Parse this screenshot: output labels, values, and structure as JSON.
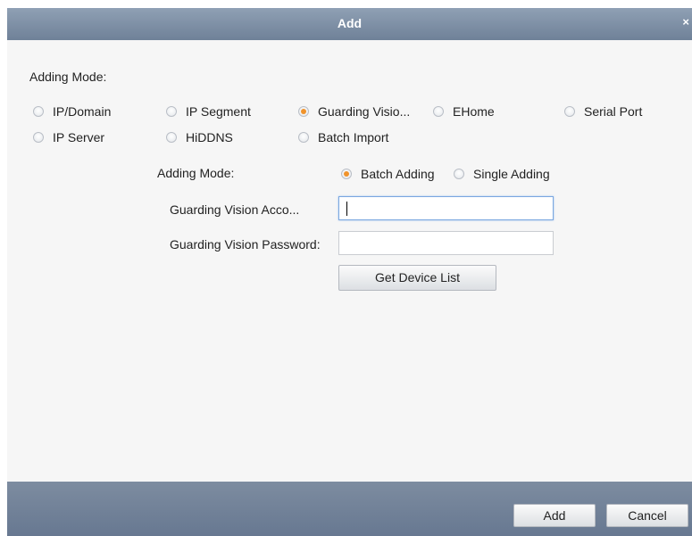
{
  "dialog": {
    "title": "Add",
    "close_glyph": "×"
  },
  "adding_mode": {
    "label": "Adding Mode:",
    "options": [
      {
        "label": "IP/Domain",
        "checked": false
      },
      {
        "label": "IP Segment",
        "checked": false
      },
      {
        "label": "Guarding Visio...",
        "checked": true
      },
      {
        "label": "EHome",
        "checked": false
      },
      {
        "label": "Serial Port",
        "checked": false
      },
      {
        "label": "IP Server",
        "checked": false
      },
      {
        "label": "HiDDNS",
        "checked": false
      },
      {
        "label": "Batch Import",
        "checked": false
      }
    ]
  },
  "guarding_form": {
    "mode_label": "Adding Mode:",
    "batch_adding_label": "Batch Adding",
    "single_adding_label": "Single Adding",
    "selected_mode": "Batch Adding",
    "account_label": "Guarding Vision Acco...",
    "account_value": "",
    "password_label": "Guarding Vision Password:",
    "password_value": "",
    "get_device_list_label": "Get Device List"
  },
  "footer": {
    "add_label": "Add",
    "cancel_label": "Cancel"
  },
  "colors": {
    "titlebar": "#7f91a7",
    "footer": "#72839a",
    "radio_checked": "#f0932b",
    "focus_border": "#7aa7e0"
  }
}
